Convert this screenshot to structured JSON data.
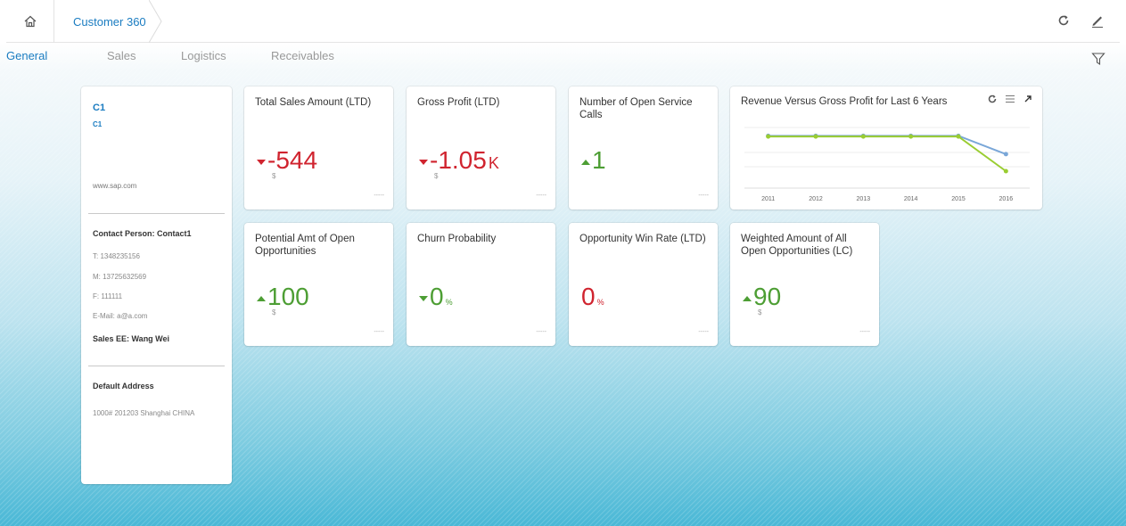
{
  "header": {
    "breadcrumb": "Customer 360"
  },
  "tabs": [
    "General",
    "Sales",
    "Logistics",
    "Receivables"
  ],
  "profile": {
    "name": "C1",
    "id": "C1",
    "website": "www.sap.com",
    "contact_person": "Contact Person: Contact1",
    "telephone": "T: 1348235156",
    "mobile": "M: 13725632569",
    "fax": "F: 111111",
    "email": "E-Mail: a@a.com",
    "sales_employee": "Sales EE: Wang Wei",
    "address_heading": "Default Address",
    "address": "1000# 201203  Shanghai CHINA"
  },
  "kpis": [
    {
      "title": "Total Sales Amount (LTD)",
      "value": "-544",
      "unit": "",
      "currency": "$",
      "trend": "down",
      "color": "#d0242f",
      "footer": "-----"
    },
    {
      "title": "Gross Profit (LTD)",
      "value": "-1.05",
      "unit": "K",
      "currency": "$",
      "trend": "down",
      "color": "#d0242f",
      "footer": "-----"
    },
    {
      "title": "Number of Open Service Calls",
      "value": "1",
      "unit": "",
      "currency": "",
      "trend": "up",
      "color": "#4d9e34",
      "footer": "-----"
    },
    {
      "title": "Potential Amt of Open Opportunities",
      "value": "100",
      "unit": "",
      "currency": "$",
      "trend": "up",
      "color": "#4d9e34",
      "footer": "-----"
    },
    {
      "title": "Churn Probability",
      "value": "0",
      "unit": "%",
      "currency": "",
      "trend": "down",
      "color": "#4d9e34",
      "footer": "-----"
    },
    {
      "title": "Opportunity Win Rate (LTD)",
      "value": "0",
      "unit": "%",
      "currency": "",
      "trend": "none",
      "color": "#d0242f",
      "footer": "-----"
    },
    {
      "title": "Weighted Amount of All Open Opportunities (LC)",
      "value": "90",
      "unit": "",
      "currency": "$",
      "trend": "up",
      "color": "#4d9e34",
      "footer": "-----"
    }
  ],
  "chart_card": {
    "title": "Revenue Versus Gross Profit for Last 6 Years",
    "tools": [
      "refresh-icon",
      "list-icon",
      "expand-icon"
    ]
  },
  "chart_data": {
    "type": "line",
    "categories": [
      "2011",
      "2012",
      "2013",
      "2014",
      "2015",
      "2016"
    ],
    "series": [
      {
        "values": [
          0,
          0,
          0,
          0,
          0,
          -544
        ],
        "color": "#7aa7d8"
      },
      {
        "values": [
          -20,
          -20,
          -20,
          -20,
          -20,
          -1050
        ],
        "color": "#9acd32"
      }
    ],
    "ylim": [
      -1500,
      300
    ],
    "grid": true
  },
  "colors": {
    "accent": "#1a7cc1",
    "negative": "#d0242f",
    "positive": "#4d9e34"
  }
}
